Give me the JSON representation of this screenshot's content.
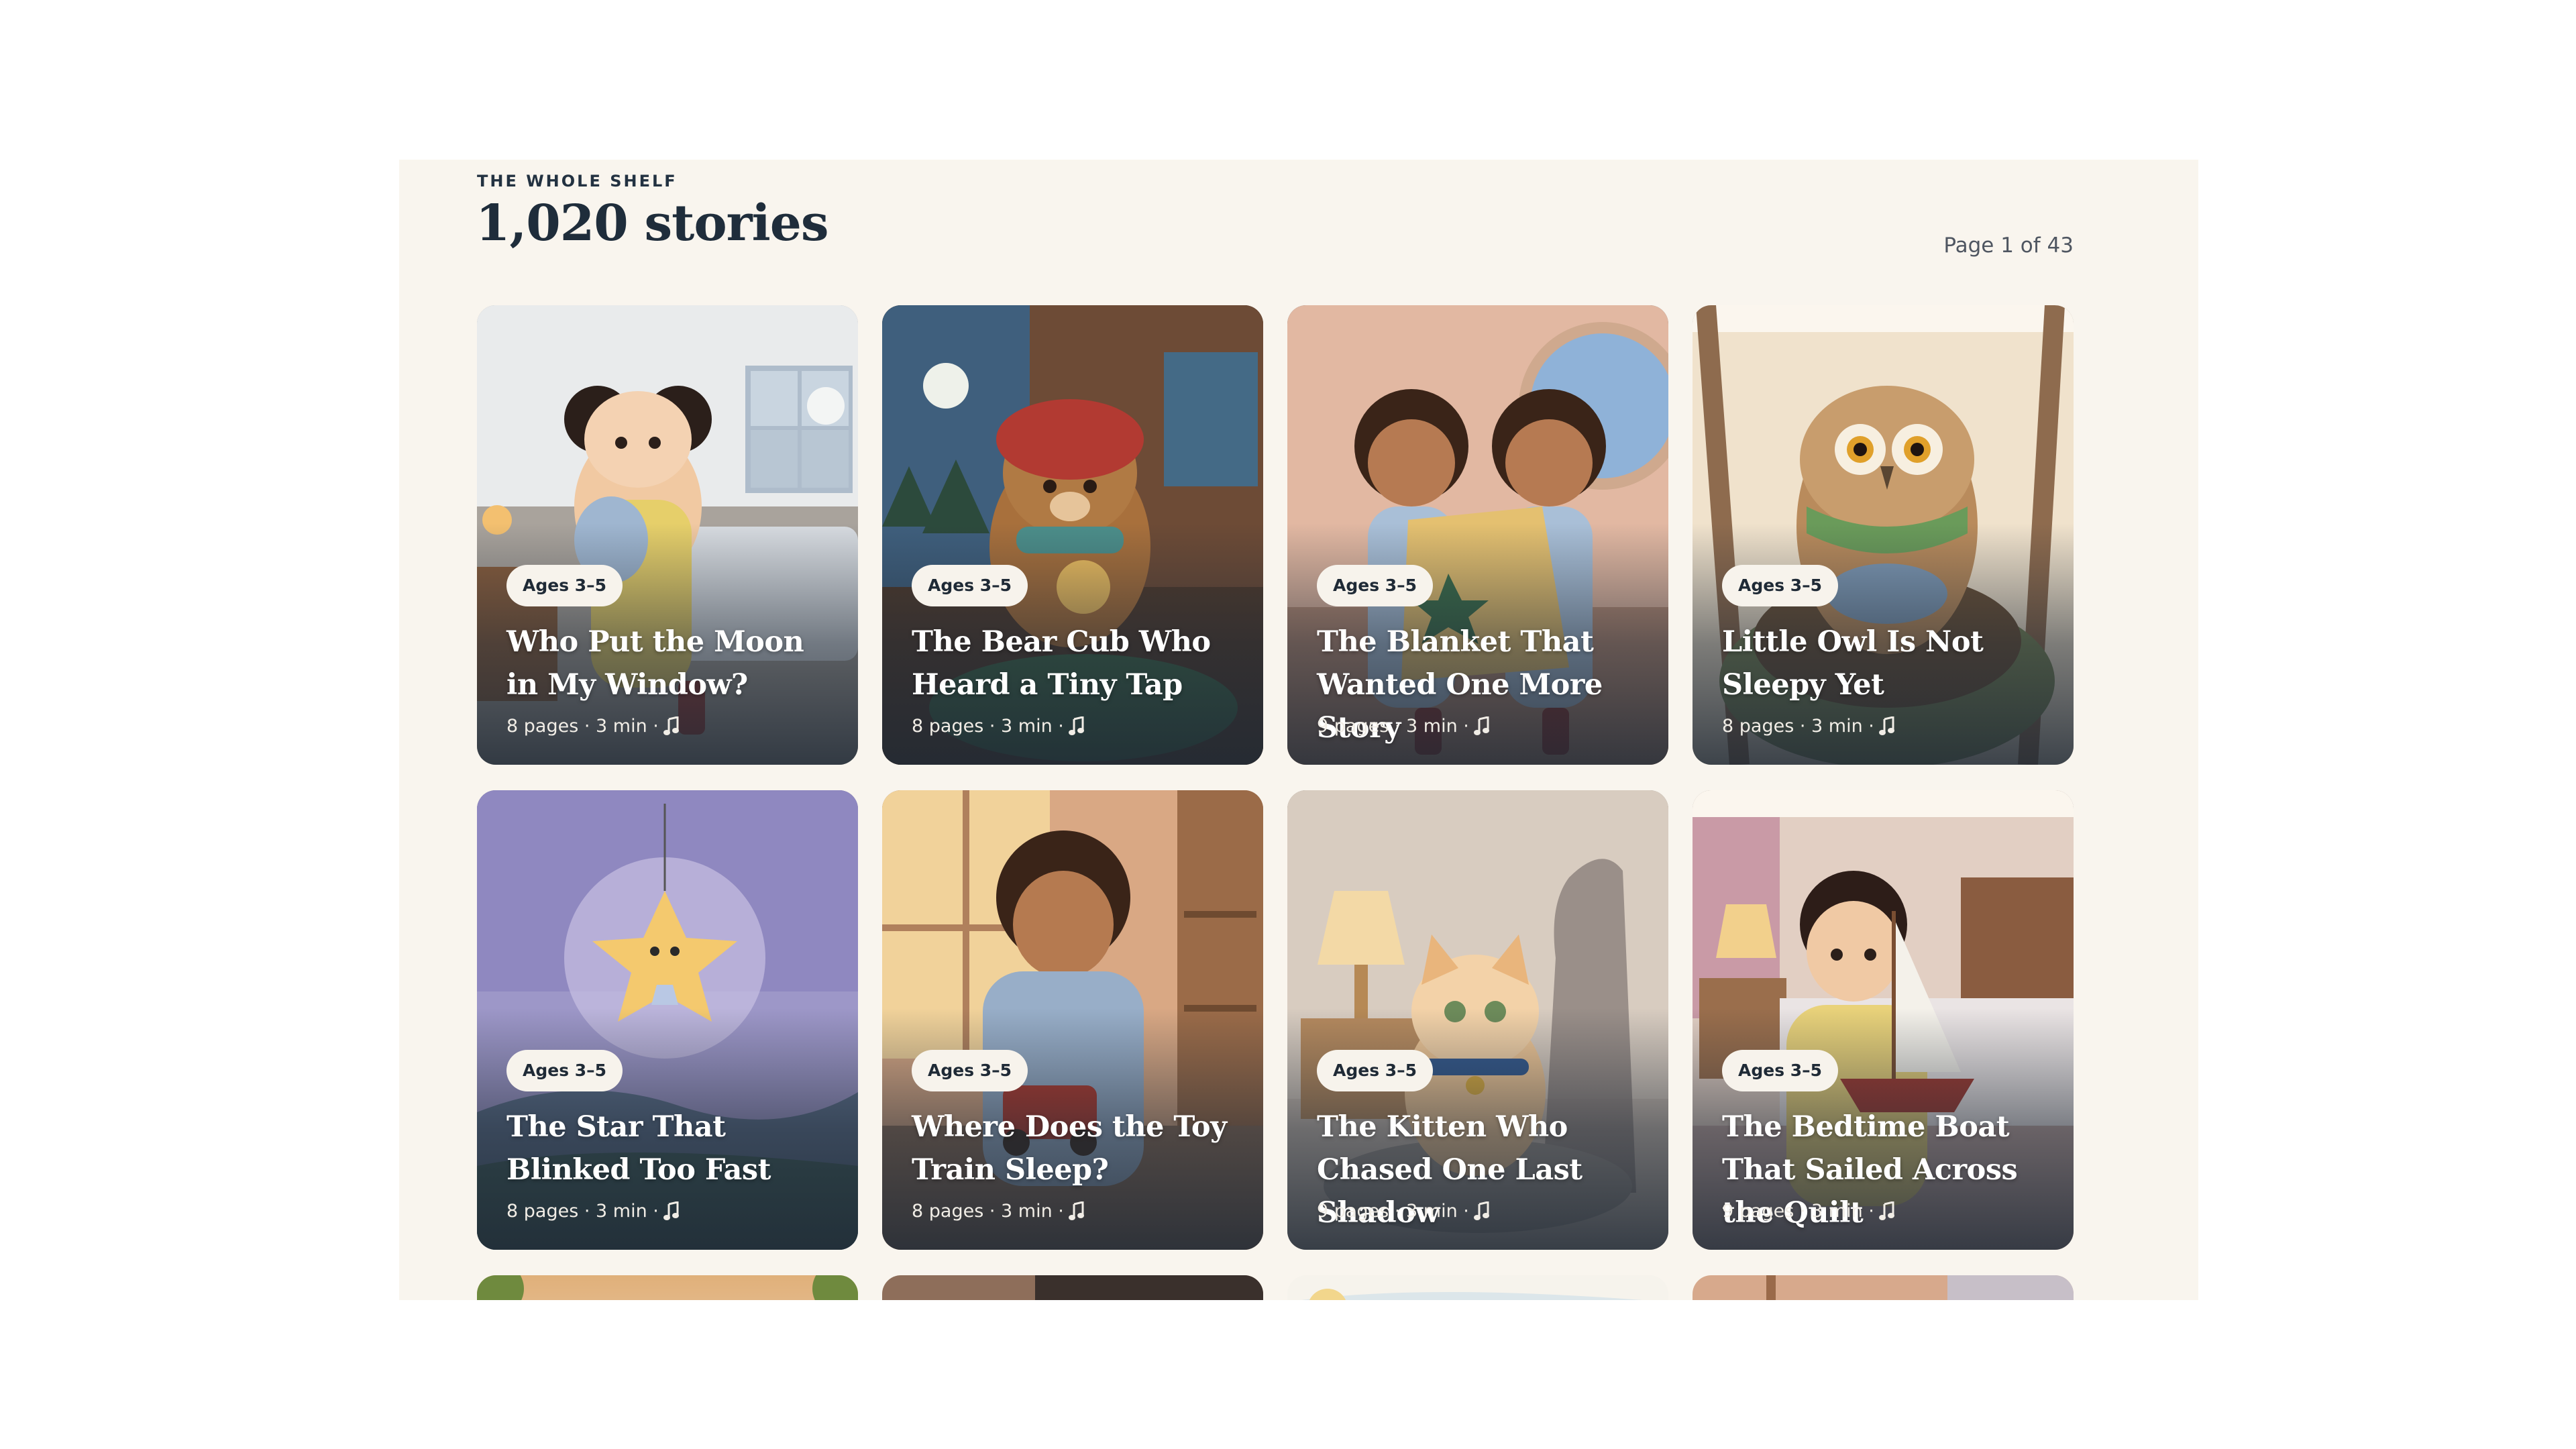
{
  "header": {
    "eyebrow": "THE WHOLE SHELF",
    "title": "1,020 stories",
    "page_indicator": "Page 1 of 43"
  },
  "cards": [
    {
      "badge": "Ages 3–5",
      "title": "Who Put the Moon in My Window?",
      "meta": "8 pages · 3 min ·",
      "audio_icon": "music-note-icon"
    },
    {
      "badge": "Ages 3–5",
      "title": "The Bear Cub Who Heard a Tiny Tap",
      "meta": "8 pages · 3 min ·",
      "audio_icon": "music-note-icon"
    },
    {
      "badge": "Ages 3–5",
      "title": "The Blanket That Wanted One More Story",
      "meta": "9 pages · 3 min ·",
      "audio_icon": "music-note-icon"
    },
    {
      "badge": "Ages 3–5",
      "title": "Little Owl Is Not Sleepy Yet",
      "meta": "8 pages · 3 min ·",
      "audio_icon": "music-note-icon"
    },
    {
      "badge": "Ages 3–5",
      "title": "The Star That Blinked Too Fast",
      "meta": "8 pages · 3 min ·",
      "audio_icon": "music-note-icon"
    },
    {
      "badge": "Ages 3–5",
      "title": "Where Does the Toy Train Sleep?",
      "meta": "8 pages · 3 min ·",
      "audio_icon": "music-note-icon"
    },
    {
      "badge": "Ages 3–5",
      "title": "The Kitten Who Chased One Last Shadow",
      "meta": "9 pages · 3 min ·",
      "audio_icon": "music-note-icon"
    },
    {
      "badge": "Ages 3–5",
      "title": "The Bedtime Boat That Sailed Across the Quilt",
      "meta": "9 pages · 3 min ·",
      "audio_icon": "music-note-icon"
    }
  ],
  "colors": {
    "panel_background": "#f9f5ee",
    "heading": "#1f2d3b",
    "badge_background": "#f7f3ec"
  }
}
